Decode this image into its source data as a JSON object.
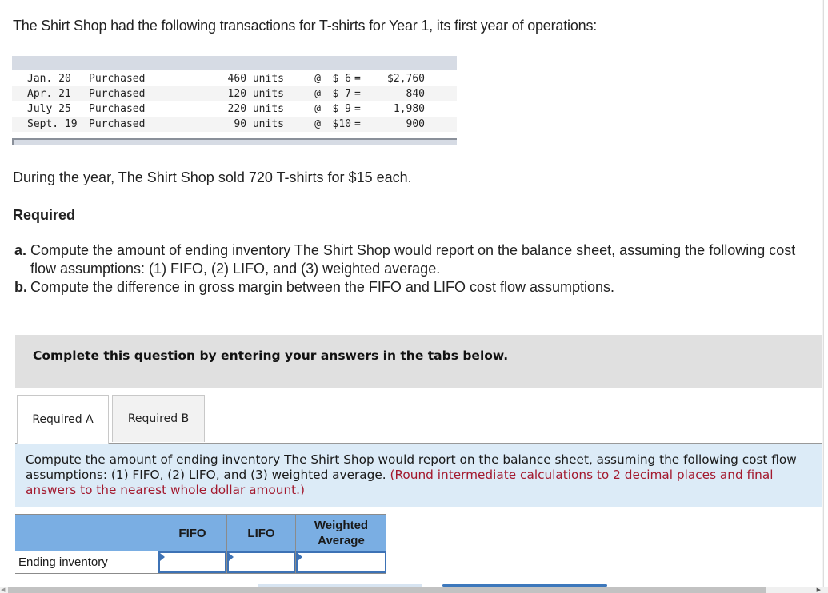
{
  "intro": "The Shirt Shop had the following transactions for T-shirts for Year 1, its first year of operations:",
  "transactions": [
    {
      "date": "Jan. 20",
      "desc": "Purchased",
      "units": "460 units",
      "at": "@",
      "price": "$ 6",
      "eq": "=",
      "total": "$2,760"
    },
    {
      "date": "Apr. 21",
      "desc": "Purchased",
      "units": "120 units",
      "at": "@",
      "price": "$ 7",
      "eq": "=",
      "total": "840"
    },
    {
      "date": "July 25",
      "desc": "Purchased",
      "units": "220 units",
      "at": "@",
      "price": "$ 9",
      "eq": "=",
      "total": "1,980"
    },
    {
      "date": "Sept. 19",
      "desc": "Purchased",
      "units": "90 units",
      "at": "@",
      "price": "$10",
      "eq": "=",
      "total": "900"
    }
  ],
  "sold_text": "During the year, The Shirt Shop sold 720 T-shirts for $15 each.",
  "required": {
    "heading": "Required",
    "items": [
      {
        "label": "a.",
        "text": "Compute the amount of ending inventory The Shirt Shop would report on the balance sheet, assuming the following cost flow assumptions: (1) FIFO, (2) LIFO, and (3) weighted average."
      },
      {
        "label": "b.",
        "text": "Compute the difference in gross margin between the FIFO and LIFO cost flow assumptions."
      }
    ]
  },
  "complete_banner": "Complete this question by entering your answers in the tabs below.",
  "tabs": [
    {
      "label": "Required A",
      "active": true
    },
    {
      "label": "Required B",
      "active": false
    }
  ],
  "instructions": {
    "line1": "Compute the amount of ending inventory The Shirt Shop would report on the balance sheet, assuming the following cost flow",
    "line2_plain": "assumptions: (1) FIFO, (2) LIFO, and (3) weighted average. ",
    "line2_red": "(Round intermediate calculations to 2 decimal places and final",
    "line3_red": "answers to the nearest whole dollar amount.)"
  },
  "answer_table": {
    "headers": [
      "",
      "FIFO",
      "LIFO",
      "Weighted Average"
    ],
    "headers_wrapped": {
      "weighted_line1": "Weighted",
      "weighted_line2": "Average"
    },
    "rows": [
      {
        "label": "Ending inventory",
        "values": [
          "",
          "",
          ""
        ]
      }
    ]
  },
  "colors": {
    "header_blue": "#7aaee3",
    "input_border": "#3d72b5",
    "instruction_bg": "#dcebf7",
    "instruction_red": "#a3192e",
    "banner_bg": "#e0e0e0"
  }
}
